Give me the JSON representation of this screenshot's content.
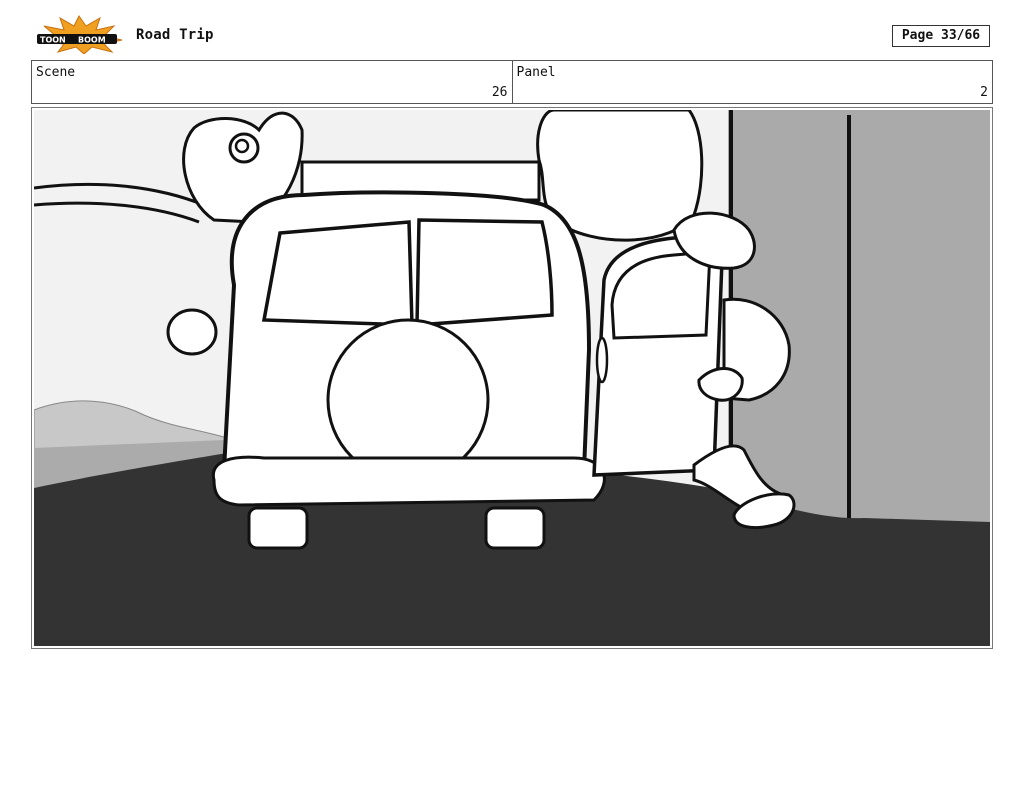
{
  "header": {
    "logo_text_left": "TOON",
    "logo_text_right": "BOOM",
    "project_title": "Road Trip",
    "page_indicator": "Page 33/66"
  },
  "info": {
    "scene_label": "Scene",
    "scene_value": "26",
    "panel_label": "Panel",
    "panel_value": "2"
  },
  "panel": {
    "image": "storyboard-sketch-van-and-character",
    "colors": {
      "asphalt": "#333333",
      "wall": "#aaaaaa",
      "sky": "#f2f2f2",
      "hills": "#c8c8c8"
    }
  }
}
